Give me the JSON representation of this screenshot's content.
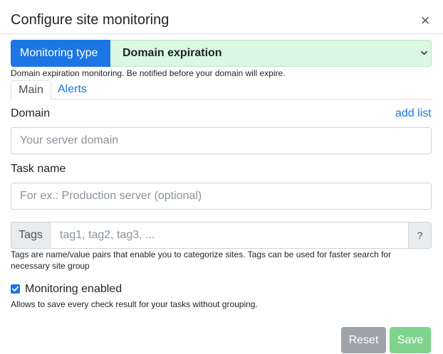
{
  "dialog": {
    "title": "Configure site monitoring",
    "close_glyph": "×"
  },
  "monitoring_type": {
    "label": "Monitoring type",
    "selected": "Domain expiration",
    "help": "Domain expiration monitoring. Be notified before your domain will expire."
  },
  "tabs": [
    {
      "label": "Main",
      "active": true
    },
    {
      "label": "Alerts",
      "active": false
    }
  ],
  "domain": {
    "label": "Domain",
    "link": "add list",
    "placeholder": "Your server domain"
  },
  "task_name": {
    "label": "Task name",
    "placeholder": "For ex.: Production server (optional)"
  },
  "tags": {
    "prefix": "Tags",
    "placeholder": "tag1, tag2, tag3, ...",
    "help_button": "?",
    "help_text_line1": "Tags are name/value pairs that enable you to categorize sites. Tags can be used for faster search for",
    "help_text_line2": "necessary site group"
  },
  "monitoring_enabled": {
    "label": "Monitoring enabled",
    "checked": true,
    "help": "Allows to save every check result for your tasks without grouping."
  },
  "buttons": {
    "reset": "Reset",
    "save": "Save"
  },
  "colors": {
    "primary": "#1b76e3",
    "select_bg": "#d9f7e1",
    "reset_bg": "#9ea3a8",
    "save_bg": "#7fd48d"
  },
  "icons": {
    "close": "close-icon",
    "select_chevron": "chevron-down-icon",
    "checkbox_check": "check-icon"
  }
}
